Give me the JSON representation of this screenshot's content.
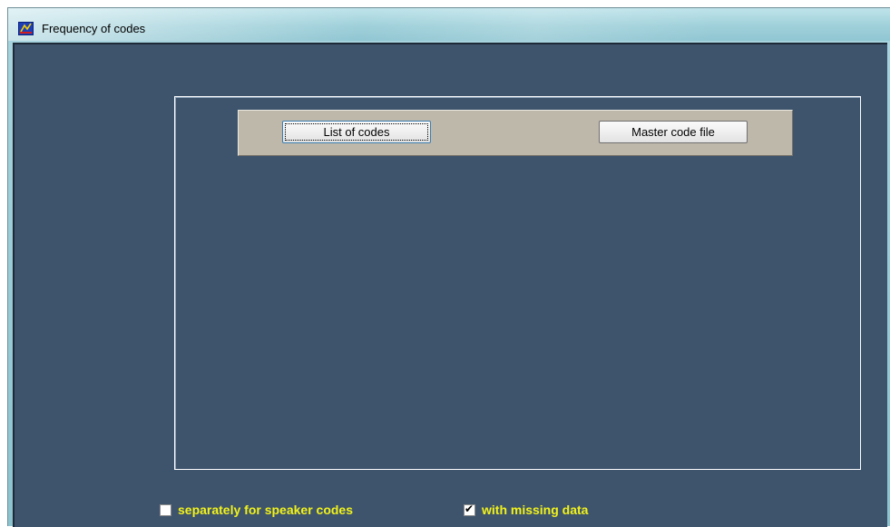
{
  "window": {
    "title": "Frequency of codes",
    "icon": "app-icon"
  },
  "toolbar": {
    "list_of_codes_label": "List of codes",
    "master_code_file_label": "Master code file"
  },
  "options": {
    "separately_label": "separately for speaker codes",
    "separately_checked": false,
    "missing_label": "with missing data",
    "missing_checked": true,
    "check_mark": "✔"
  },
  "colors": {
    "background": "#3e546d",
    "label_yellow": "#f2f21a",
    "toolbar": "#beb8ab"
  }
}
